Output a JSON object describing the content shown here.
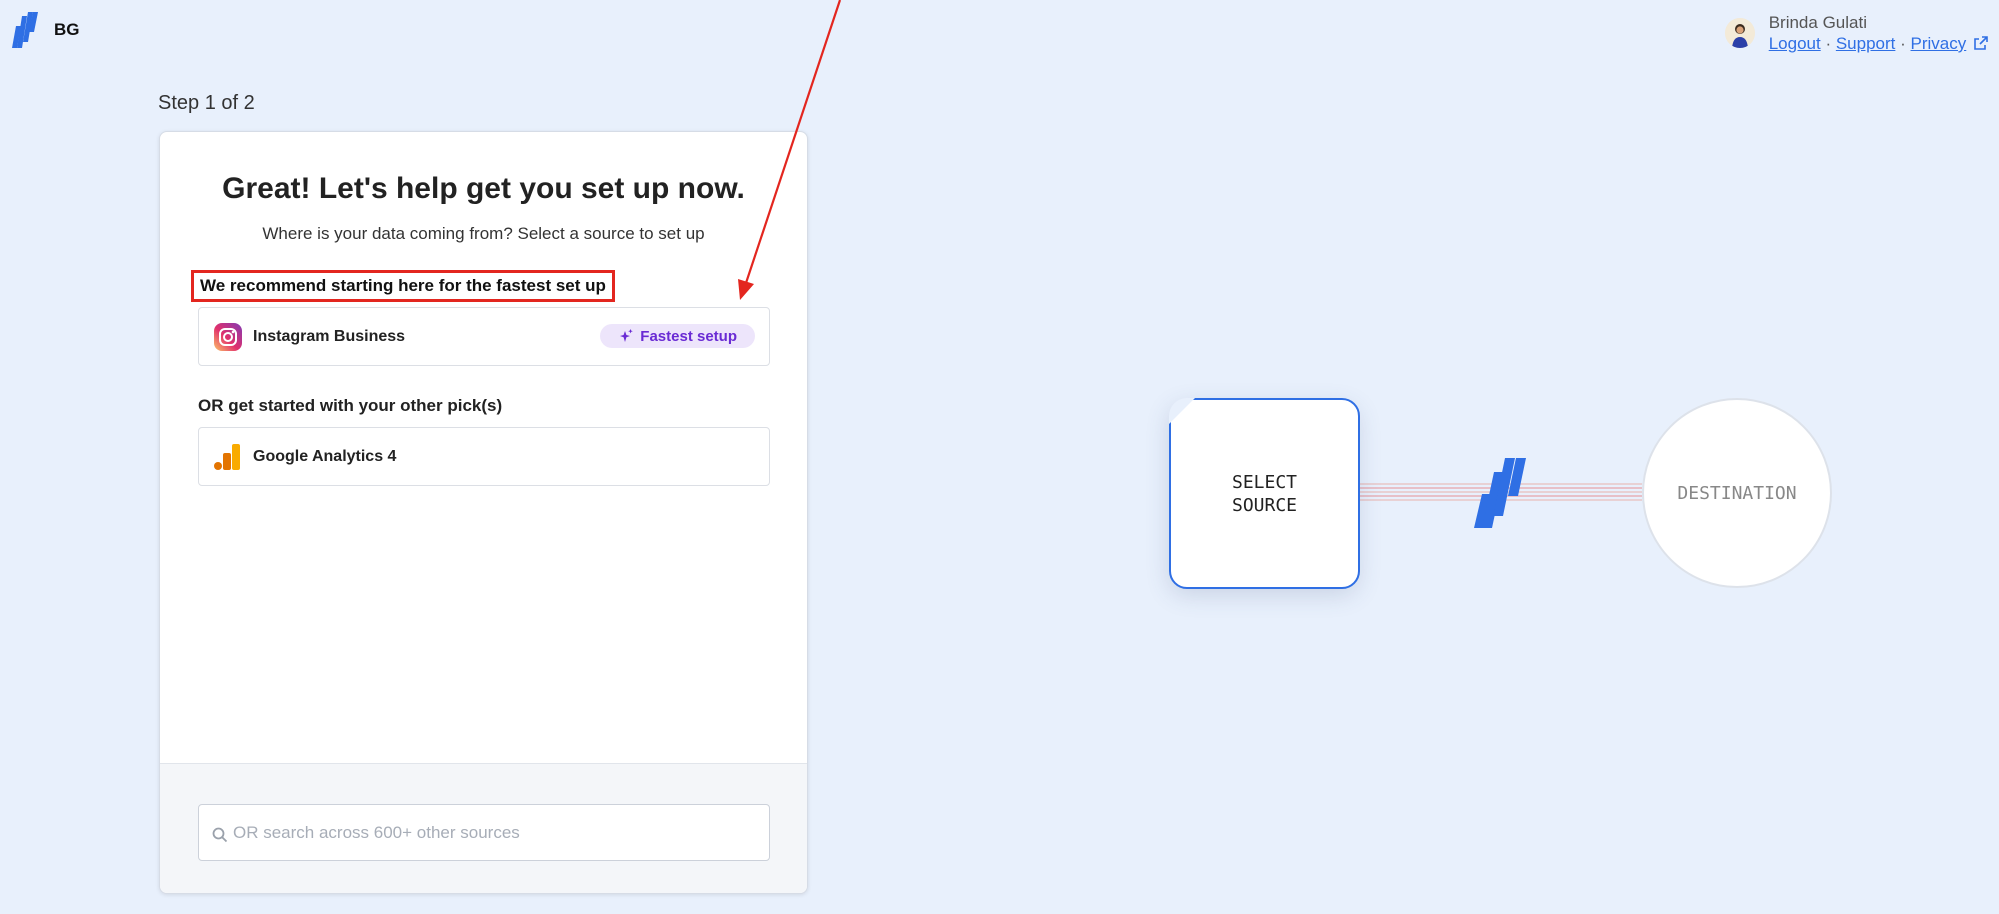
{
  "header": {
    "brand_initials": "BG",
    "user_name": "Brinda Gulati",
    "links": {
      "logout": "Logout",
      "support": "Support",
      "privacy": "Privacy",
      "separator": "·"
    }
  },
  "step_indicator": "Step 1 of 2",
  "card": {
    "title": "Great! Let's help get you set up now.",
    "subtitle": "Where is your data coming from? Select a source to set up",
    "recommend_label": "We recommend starting here for the fastest set up",
    "recommended_source": {
      "name": "Instagram Business",
      "badge": "Fastest setup"
    },
    "other_label": "OR get started with your other pick(s)",
    "other_sources": [
      {
        "name": "Google Analytics 4"
      }
    ],
    "search": {
      "placeholder": "OR search across 600+ other sources",
      "value": ""
    }
  },
  "diagram": {
    "source_label": "SELECT\nSOURCE",
    "destination_label": "DESTINATION"
  },
  "colors": {
    "accent": "#2f6fe4",
    "highlight_red": "#e3261f",
    "badge_purple": "#6a2bd4",
    "background": "#e8f0fc"
  }
}
